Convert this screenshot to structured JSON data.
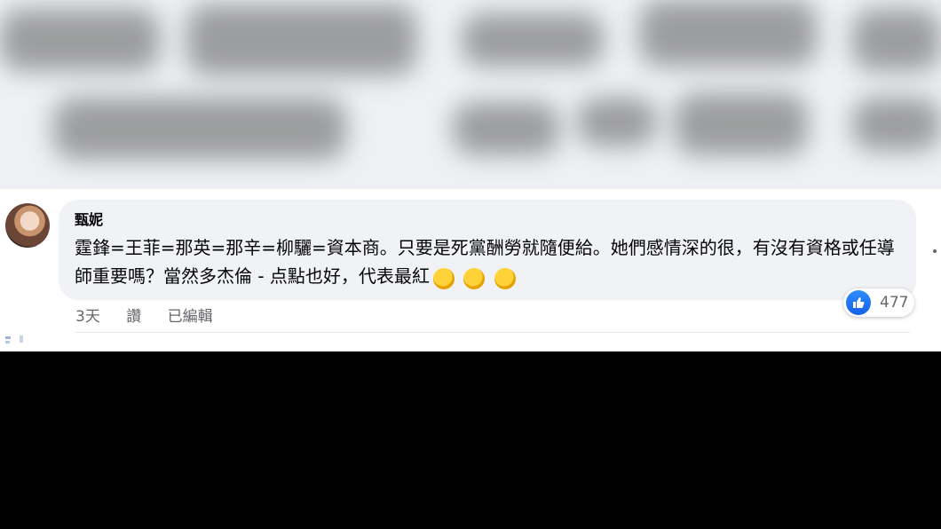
{
  "comment": {
    "author": "甄妮",
    "text": "霆鋒=王菲=那英=那辛=柳驪=資本商。只要是死黨酬勞就隨便給。她們感情深的很，有沒有資格或任導師重要嗎？當然多杰倫 - 点點也好，代表最紅",
    "emojis": [
      "clapping-hands",
      "clapping-hands",
      "clapping-hands"
    ]
  },
  "meta": {
    "time": "3天",
    "like_action": "讚",
    "edited": "已編輯"
  },
  "reactions": {
    "type": "like",
    "count": "477"
  },
  "colors": {
    "bubble": "#f0f2f5",
    "meta_text": "#65676b",
    "like_blue": "#1877f2"
  }
}
